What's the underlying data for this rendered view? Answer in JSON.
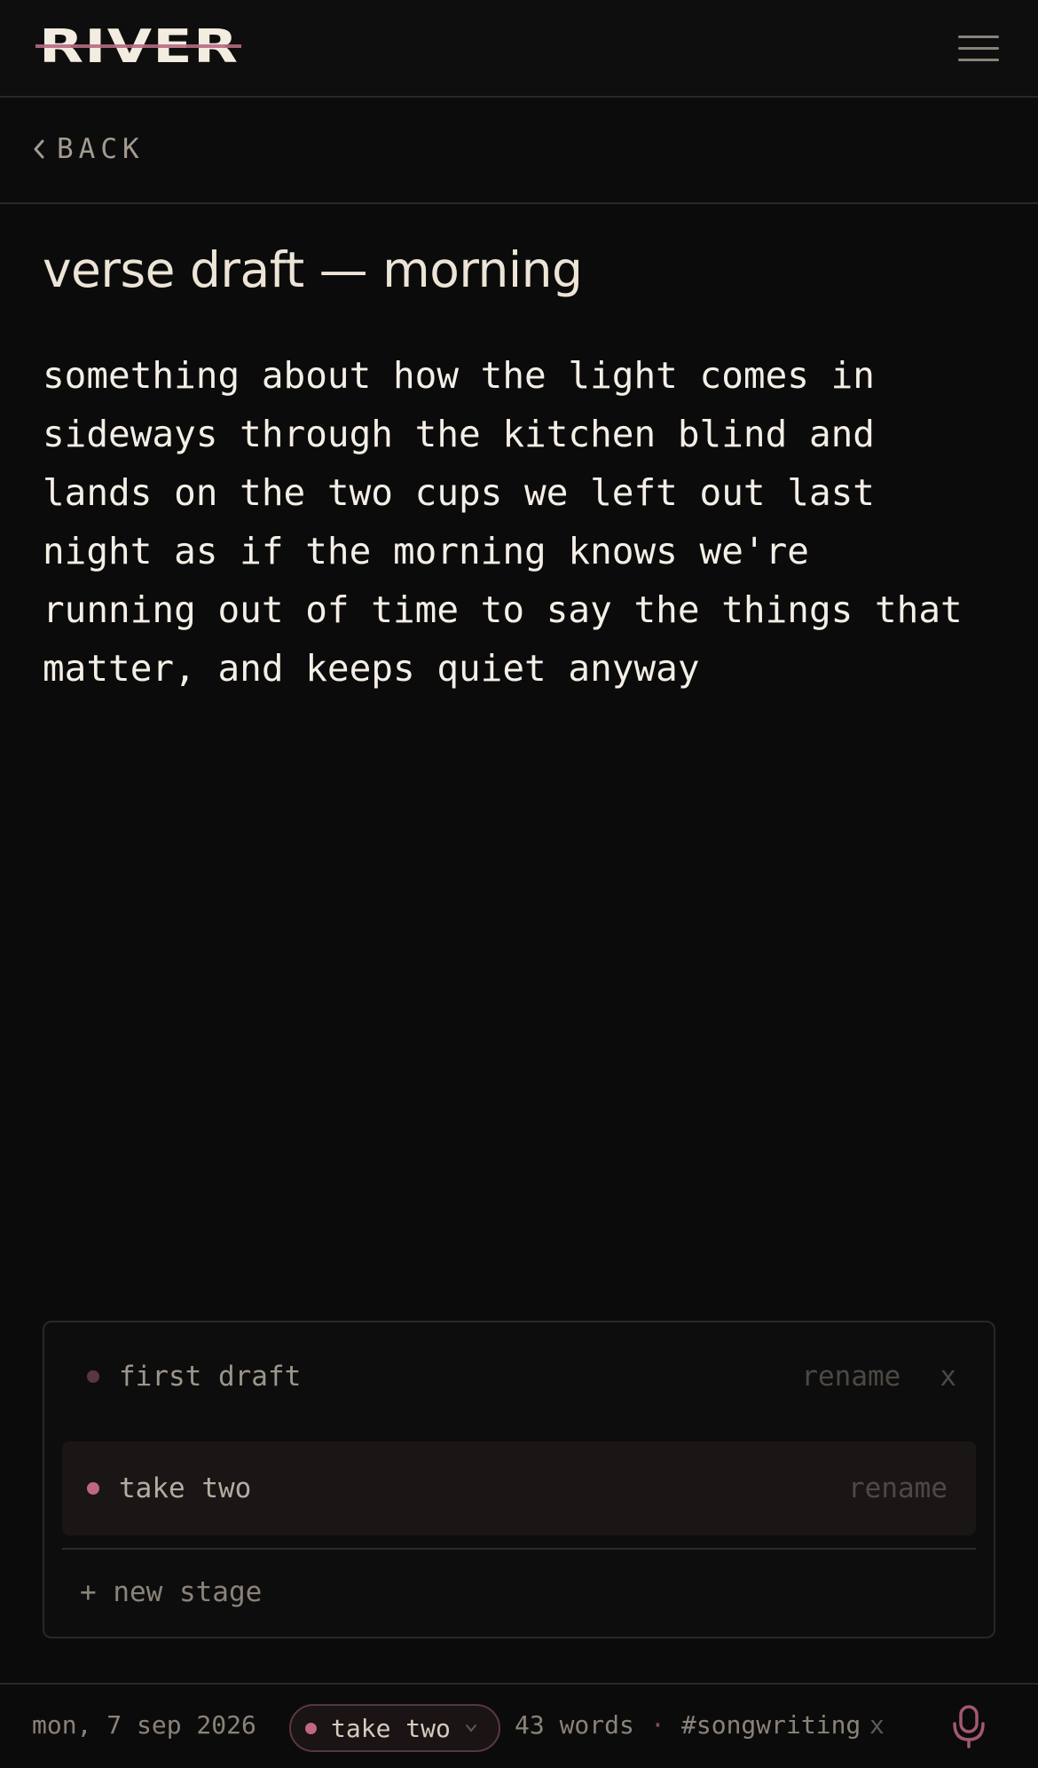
{
  "header": {
    "logo_text": "RIVER",
    "menu_icon": "hamburger-menu-icon"
  },
  "nav": {
    "back_label": "BACK",
    "back_icon": "chevron-left-icon"
  },
  "note": {
    "title": "verse draft — morning",
    "body": "something about how the light comes in\nsideways through the kitchen blind and\nlands on the two cups we left out last\nnight as if the morning knows we're\nrunning out of time to say the things that\nmatter, and keeps quiet anyway"
  },
  "stages": {
    "items": [
      {
        "name": "first draft",
        "rename_label": "rename",
        "delete_label": "x",
        "active": false
      },
      {
        "name": "take two",
        "rename_label": "rename",
        "active": true
      }
    ],
    "new_stage_label": "+ new stage"
  },
  "footer": {
    "date": "mon, 7 sep 2026",
    "current_stage": "take two",
    "word_count": "43 words",
    "separator": "·",
    "tag": "#songwriting",
    "tag_remove": "x",
    "mic_icon": "microphone-icon"
  },
  "colors": {
    "background": "#0c0b0b",
    "text": "#ece4d6",
    "accent": "#c06880",
    "muted": "#8a8379"
  }
}
